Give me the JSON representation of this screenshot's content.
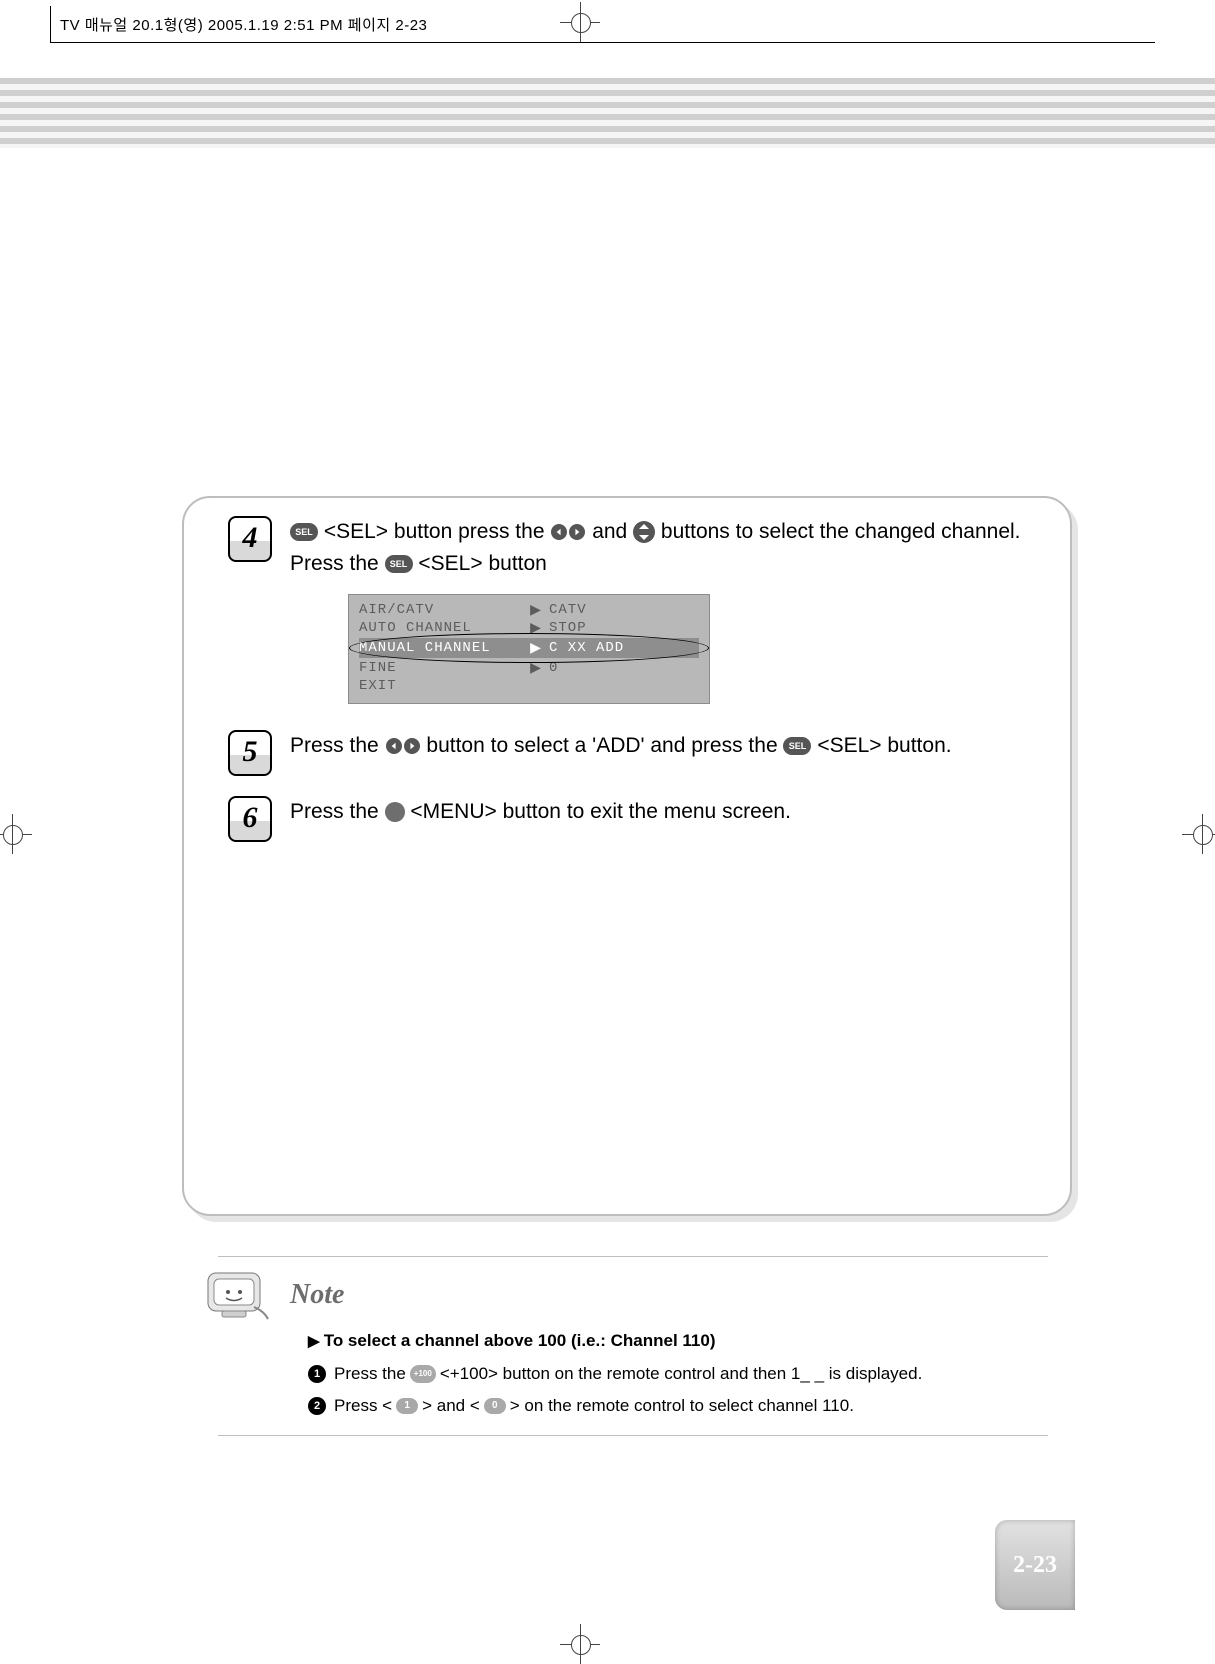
{
  "print_header": "TV 매뉴얼 20.1형(영) 2005.1.19 2:51 PM 페이지 2-23",
  "page_number": "2-23",
  "icon_labels": {
    "sel": "SEL",
    "menu": "",
    "plus100": "+100",
    "num1": "1",
    "num0": "0"
  },
  "steps": [
    {
      "num": "4",
      "segments": {
        "a": "<SEL> button press the",
        "b": "and",
        "c": "buttons to select the changed channel. Press the",
        "d": "<SEL> button"
      }
    },
    {
      "num": "5",
      "segments": {
        "a": "Press the",
        "b": "button to select a 'ADD' and press the",
        "c": "<SEL> button."
      }
    },
    {
      "num": "6",
      "segments": {
        "a": "Press the",
        "b": "<MENU> button to exit the menu screen."
      }
    }
  ],
  "osd": {
    "rows": [
      {
        "left": "AIR/CATV",
        "right": "CATV",
        "hl": false
      },
      {
        "left": "AUTO CHANNEL",
        "right": "STOP",
        "hl": false
      },
      {
        "left": "MANUAL CHANNEL",
        "right": "C XX ADD",
        "hl": true
      },
      {
        "left": "FINE",
        "right": "0",
        "hl": false
      },
      {
        "left": "EXIT",
        "right": "",
        "hl": false
      }
    ]
  },
  "note": {
    "title": "Note",
    "subhead": "To select a channel above 100 (i.e.: Channel 110)",
    "line1": {
      "a": "Press the",
      "b": "<+100> button on the remote control and then 1_ _ is displayed."
    },
    "line2": {
      "a": "Press <",
      "b": "> and <",
      "c": "> on the remote control to select channel 110."
    }
  }
}
